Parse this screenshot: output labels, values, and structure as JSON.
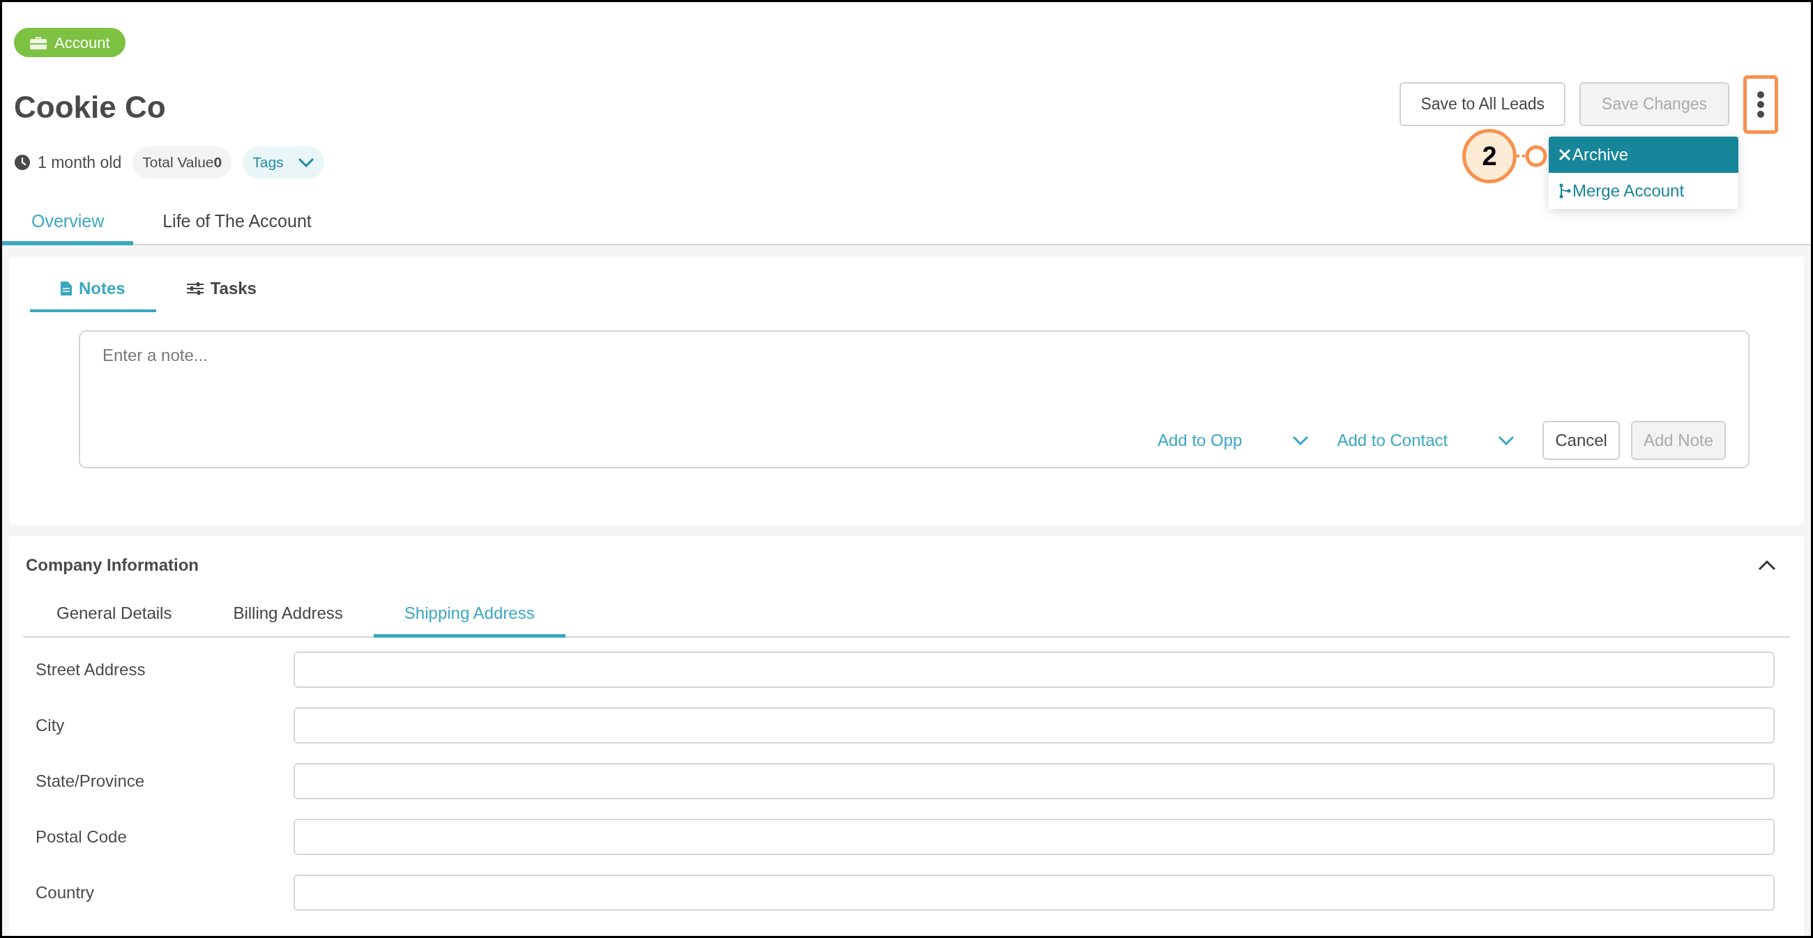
{
  "record_type": {
    "label": "Account"
  },
  "title": "Cookie Co",
  "meta": {
    "age": "1 month old",
    "total_value_label": "Total Value",
    "total_value": "0",
    "tags_label": "Tags"
  },
  "actions": [
    {
      "label": "Save to All Leads",
      "disabled": false
    },
    {
      "label": "Save Changes",
      "disabled": true
    }
  ],
  "more_menu": {
    "highlighted": true,
    "items": [
      {
        "label": "Archive",
        "kind": "archive",
        "selected": true
      },
      {
        "label": "Merge Account",
        "kind": "merge",
        "selected": false
      }
    ]
  },
  "annotation": {
    "label": "2"
  },
  "tabs": [
    {
      "label": "Overview",
      "selected": true
    },
    {
      "label": "Life of The Account",
      "selected": false
    }
  ],
  "activity_tabs": [
    {
      "label": "Notes",
      "kind": "notes",
      "selected": true
    },
    {
      "label": "Tasks",
      "kind": "tasks",
      "selected": false
    }
  ],
  "note_editor": {
    "placeholder": "Enter a note...",
    "links": [
      "Add to Opp",
      "Add to Contact"
    ],
    "buttons": [
      {
        "label": "Cancel",
        "disabled": false
      },
      {
        "label": "Add Note",
        "disabled": true
      }
    ]
  },
  "company_info": {
    "title": "Company Information",
    "expanded": true,
    "tabs": [
      {
        "label": "General Details",
        "selected": false
      },
      {
        "label": "Billing Address",
        "selected": false
      },
      {
        "label": "Shipping Address",
        "selected": true
      }
    ],
    "fields": [
      {
        "label": "Street Address"
      },
      {
        "label": "City"
      },
      {
        "label": "State/Province"
      },
      {
        "label": "Postal Code"
      },
      {
        "label": "Country"
      }
    ]
  }
}
